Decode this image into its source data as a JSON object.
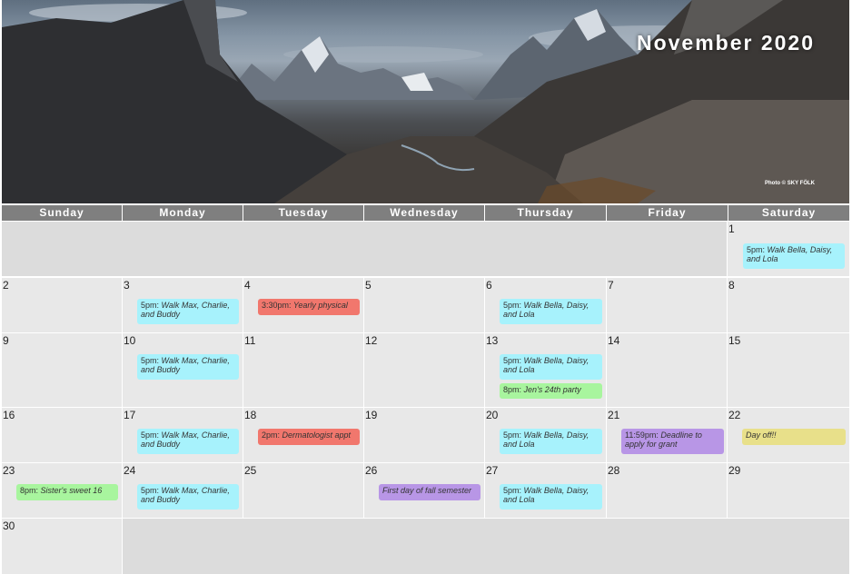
{
  "header": {
    "title": "November 2020",
    "photo_credit": "Photo © SKY FÖLK"
  },
  "weekdays": [
    "Sunday",
    "Monday",
    "Tuesday",
    "Wednesday",
    "Thursday",
    "Friday",
    "Saturday"
  ],
  "days": {
    "d1": "1",
    "d2": "2",
    "d3": "3",
    "d4": "4",
    "d5": "5",
    "d6": "6",
    "d7": "7",
    "d8": "8",
    "d9": "9",
    "d10": "10",
    "d11": "11",
    "d12": "12",
    "d13": "13",
    "d14": "14",
    "d15": "15",
    "d16": "16",
    "d17": "17",
    "d18": "18",
    "d19": "19",
    "d20": "20",
    "d21": "21",
    "d22": "22",
    "d23": "23",
    "d24": "24",
    "d25": "25",
    "d26": "26",
    "d27": "27",
    "d28": "28",
    "d29": "29",
    "d30": "30"
  },
  "events": {
    "walk_bdl": {
      "time": "5pm:",
      "desc": " Walk Bella, Daisy, and Lola"
    },
    "walk_mcb": {
      "time": "5pm:",
      "desc": " Walk Max, Charlie, and Buddy"
    },
    "physical": {
      "time": "3:30pm:",
      "desc": " Yearly physical"
    },
    "jen": {
      "time": "8pm:",
      "desc": " Jen's 24th party"
    },
    "derm": {
      "time": "2pm:",
      "desc": " Dermatologist appt"
    },
    "grant": {
      "time": "11:59pm:",
      "desc": " Deadline to apply for grant"
    },
    "dayoff": {
      "time": "",
      "desc": "Day off!!"
    },
    "sister": {
      "time": "8pm:",
      "desc": " Sister's sweet 16"
    },
    "fall": {
      "time": "",
      "desc": "First day of fall semester"
    }
  },
  "colors": {
    "blue": "#a7f2fc",
    "red": "#f1776d",
    "green": "#a8f59e",
    "purple": "#b896e6",
    "yellow": "#e8e08a",
    "header_bar": "#7f7f7f"
  }
}
